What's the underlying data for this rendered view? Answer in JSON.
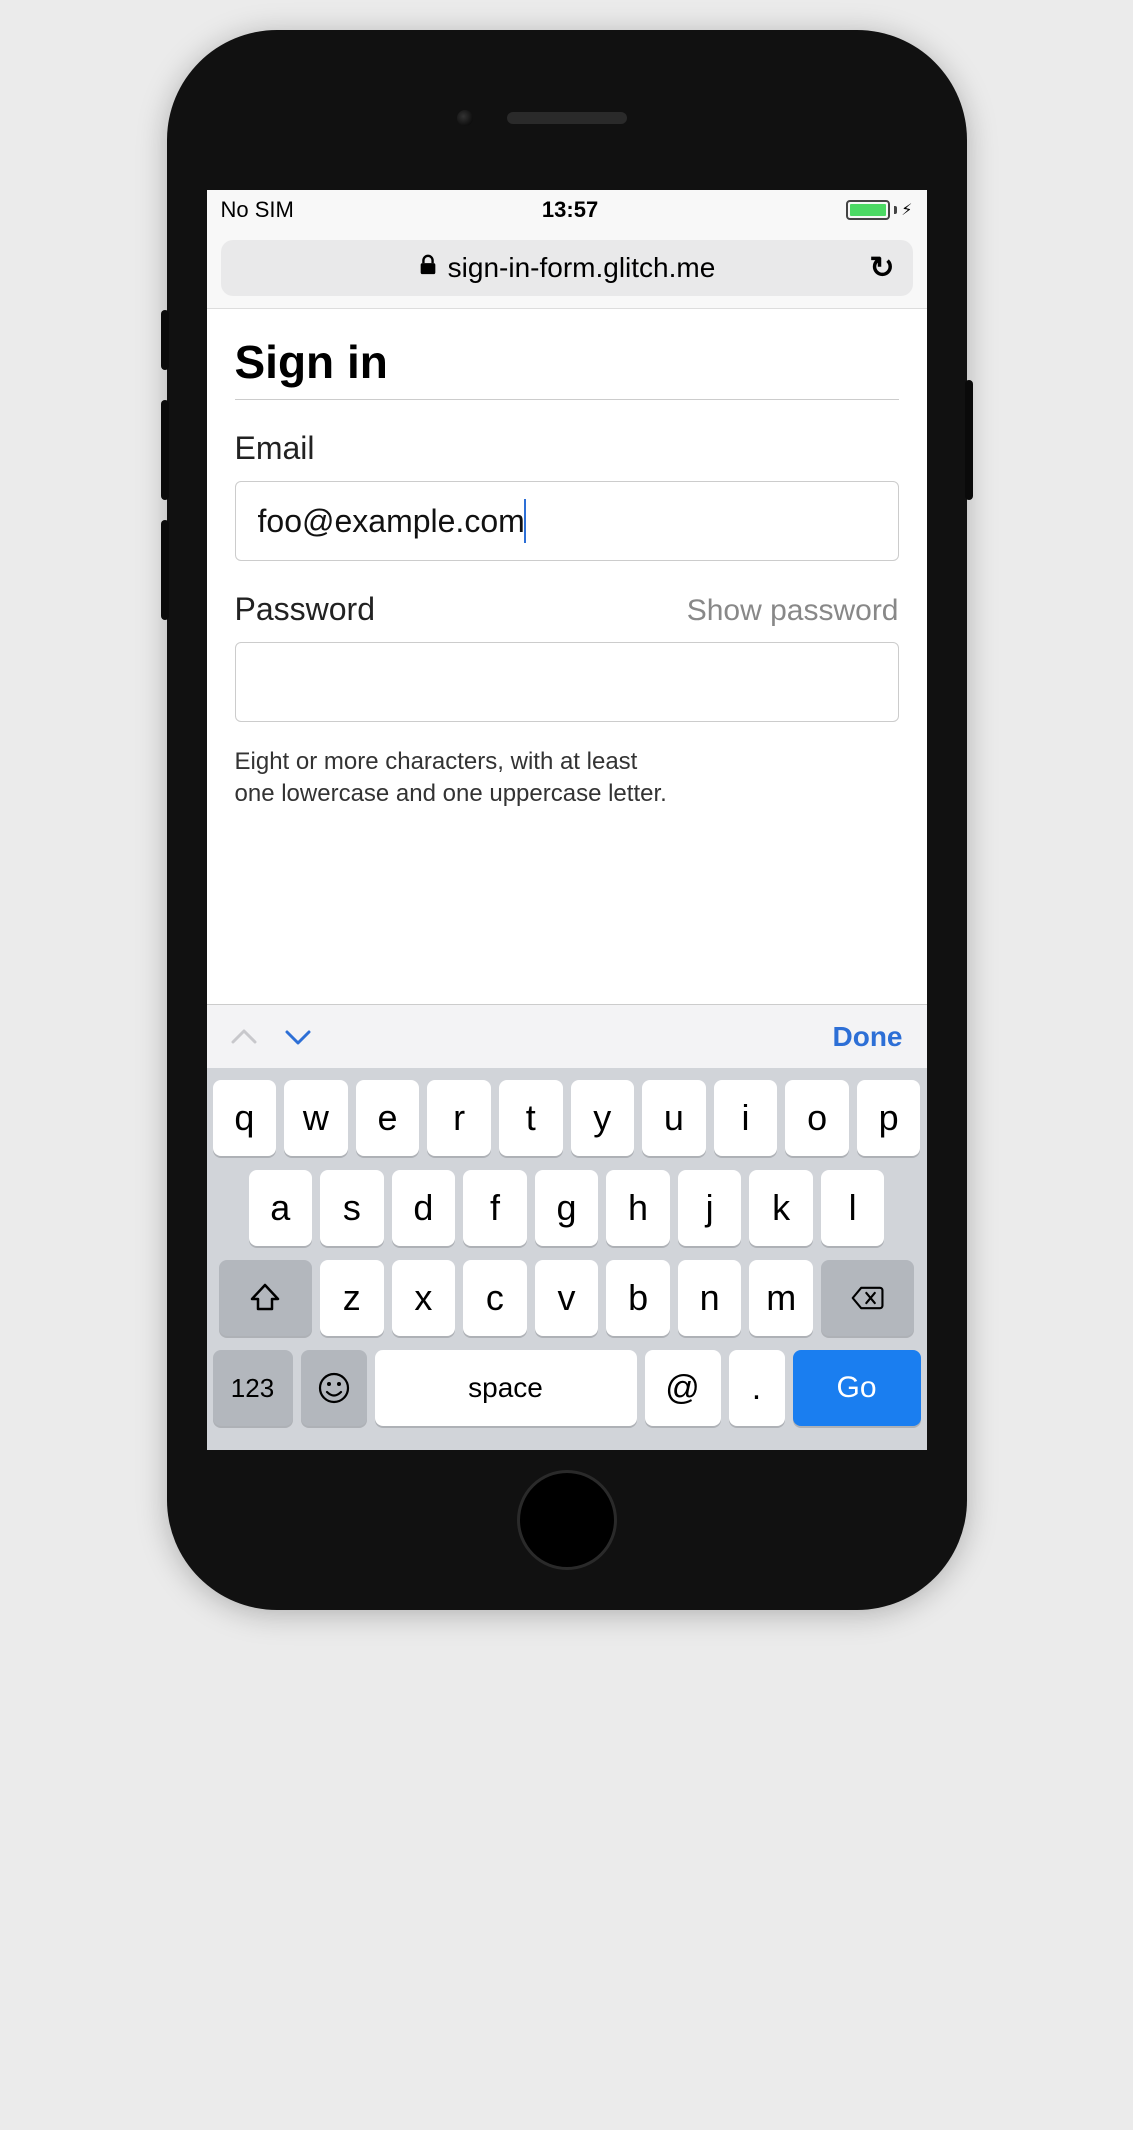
{
  "status": {
    "left": "No SIM",
    "time": "13:57"
  },
  "browser": {
    "url": "sign-in-form.glitch.me"
  },
  "page": {
    "title": "Sign in",
    "email_label": "Email",
    "email_value": "foo@example.com",
    "password_label": "Password",
    "show_password": "Show password",
    "password_value": "",
    "hint_line1": "Eight or more characters, with at least",
    "hint_line2": "one lowercase and one uppercase letter."
  },
  "keyboard": {
    "done": "Done",
    "row1": [
      "q",
      "w",
      "e",
      "r",
      "t",
      "y",
      "u",
      "i",
      "o",
      "p"
    ],
    "row2": [
      "a",
      "s",
      "d",
      "f",
      "g",
      "h",
      "j",
      "k",
      "l"
    ],
    "row3": [
      "z",
      "x",
      "c",
      "v",
      "b",
      "n",
      "m"
    ],
    "k123": "123",
    "space": "space",
    "at": "@",
    "dot": ".",
    "go": "Go"
  }
}
